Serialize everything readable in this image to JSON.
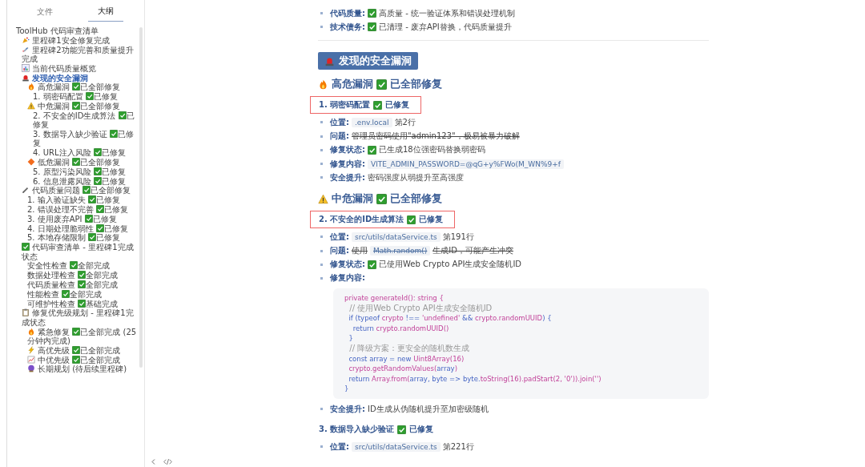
{
  "sidebar": {
    "tabs": [
      {
        "label": "文件",
        "selected": false
      },
      {
        "label": "大纲",
        "selected": true
      }
    ],
    "outline": [
      {
        "text": "ToolHub 代码审查清单",
        "selected": false,
        "children": [
          {
            "text": "里程碑1安全修复完成",
            "kind": "milestone",
            "selected": false
          },
          {
            "text": "里程碑2功能完善和质量提升完成",
            "kind": "launch",
            "selected": false
          },
          {
            "text": "当前代码质量概览",
            "kind": "overview",
            "selected": false
          },
          {
            "text": "发现的安全漏洞",
            "kind": "alert",
            "selected": true,
            "children": [
              {
                "text": "高危漏洞",
                "kind": "high",
                "done": true,
                "status": "已全部修复",
                "selected": false,
                "children": [
                  {
                    "text": "1. 弱密码配置",
                    "done": true,
                    "status": "已修复",
                    "selected": false
                  }
                ]
              },
              {
                "text": "中危漏洞",
                "kind": "medium",
                "done": true,
                "status": "已全部修复",
                "selected": false,
                "children": [
                  {
                    "text": "2. 不安全的ID生成算法",
                    "done": true,
                    "status": "已修复",
                    "selected": false
                  },
                  {
                    "text": "3. 数据导入缺少验证",
                    "done": true,
                    "status": "已修复",
                    "selected": false
                  },
                  {
                    "text": "4. URL注入风险",
                    "done": true,
                    "status": "已修复",
                    "selected": false
                  }
                ]
              },
              {
                "text": "低危漏洞",
                "kind": "low",
                "done": true,
                "status": "已全部修复",
                "selected": false,
                "children": [
                  {
                    "text": "5. 原型污染风险",
                    "done": true,
                    "status": "已修复",
                    "selected": false
                  },
                  {
                    "text": "6. 信息泄露风险",
                    "done": true,
                    "status": "已修复",
                    "selected": false
                  }
                ]
              }
            ]
          },
          {
            "text": "代码质量问题",
            "kind": "quality",
            "done": true,
            "status": "已全部修复",
            "selected": false,
            "children": [
              {
                "text": "1. 输入验证缺失",
                "done": true,
                "status": "已修复",
                "selected": false
              },
              {
                "text": "2. 错误处理不完善",
                "done": true,
                "status": "已修复",
                "selected": false
              },
              {
                "text": "3. 使用废弃API",
                "done": true,
                "status": "已修复",
                "selected": false
              },
              {
                "text": "4. 日期处理脆弱性",
                "done": true,
                "status": "已修复",
                "selected": false
              },
              {
                "text": "5. 本地存储限制",
                "done": true,
                "status": "已修复",
                "selected": false
              }
            ]
          },
          {
            "text": "代码审查清单 - 里程碑1完成状态",
            "kind": "checklist",
            "selected": false,
            "children": [
              {
                "text": "安全性检查",
                "done": true,
                "status": "全部完成",
                "selected": false
              },
              {
                "text": "数据处理检查",
                "done": true,
                "status": "全部完成",
                "selected": false
              },
              {
                "text": "代码质量检查",
                "done": true,
                "status": "全部完成",
                "selected": false
              },
              {
                "text": "性能检查",
                "done": true,
                "status": "全部完成",
                "selected": false
              },
              {
                "text": "可维护性检查",
                "done": true,
                "status": "基础完成",
                "selected": false
              }
            ]
          },
          {
            "text": "修复优先级规划 - 里程碑1完成状态",
            "kind": "plan",
            "selected": false,
            "children": [
              {
                "text": "紧急修复",
                "kind": "urgent",
                "done": true,
                "status": "已全部完成 (25分钟内完成)",
                "selected": false
              },
              {
                "text": "高优先级",
                "kind": "priority-high",
                "done": true,
                "status": "已全部完成",
                "selected": false
              },
              {
                "text": "中优先级",
                "kind": "priority-mid",
                "done": true,
                "status": "已全部完成",
                "selected": false
              },
              {
                "text": "长期规划 (待后续里程碑)",
                "kind": "longterm",
                "selected": false
              }
            ]
          }
        ]
      }
    ]
  },
  "summary": [
    {
      "label": "代码质量:",
      "struck": false,
      "segments": [
        {
          "kind": "check"
        },
        {
          "kind": "text",
          "text": "高质量 - 统一验证体系和错误处理机制"
        }
      ]
    },
    {
      "label": "技术债务:",
      "struck": false,
      "segments": [
        {
          "kind": "check"
        },
        {
          "kind": "text",
          "text": "已清理 - 废弃API替换，代码质量提升"
        }
      ]
    }
  ],
  "section": {
    "title": "发现的安全漏洞",
    "kind": "alert",
    "groups": [
      {
        "title": "高危漏洞",
        "kind": "high",
        "done": true,
        "status": "已全部修复",
        "issues": [
          {
            "title": "1. 弱密码配置",
            "done": true,
            "status": "已修复",
            "highlighted": true,
            "bullets": [
              {
                "label": "位置:",
                "struck": false,
                "segments": [
                  {
                    "kind": "code",
                    "text": ".env.local"
                  },
                  {
                    "kind": "text",
                    "text": "第2行"
                  }
                ]
              },
              {
                "label": "问题:",
                "struck": true,
                "segments": [
                  {
                    "kind": "text",
                    "text": "管理员密码使用\"admin123\"，极易被暴力破解"
                  }
                ]
              },
              {
                "label": "修复状态:",
                "struck": false,
                "segments": [
                  {
                    "kind": "check"
                  },
                  {
                    "kind": "text",
                    "text": "已生成18位强密码替换弱密码"
                  }
                ]
              },
              {
                "label": "修复内容:",
                "struck": false,
                "segments": [
                  {
                    "kind": "code",
                    "text": "VITE_ADMIN_PASSWORD=@qG+y%FWo(M_WN%9+f"
                  }
                ]
              },
              {
                "label": "安全提升:",
                "struck": false,
                "segments": [
                  {
                    "kind": "text",
                    "text": "密码强度从弱提升至高强度"
                  }
                ]
              }
            ]
          }
        ]
      },
      {
        "title": "中危漏洞",
        "kind": "medium",
        "done": true,
        "status": "已全部修复",
        "issues": [
          {
            "title": "2. 不安全的ID生成算法",
            "done": true,
            "status": "已修复",
            "highlighted": true,
            "bullets": [
              {
                "label": "位置:",
                "struck": false,
                "segments": [
                  {
                    "kind": "code",
                    "text": "src/utils/dataService.ts"
                  },
                  {
                    "kind": "text",
                    "text": "第191行"
                  }
                ]
              },
              {
                "label": "问题:",
                "struck": true,
                "segments": [
                  {
                    "kind": "text",
                    "text": "使用"
                  },
                  {
                    "kind": "code",
                    "text": "Math.random()"
                  },
                  {
                    "kind": "text",
                    "text": "生成ID，可能产生冲突"
                  }
                ]
              },
              {
                "label": "修复状态:",
                "struck": false,
                "segments": [
                  {
                    "kind": "check"
                  },
                  {
                    "kind": "text",
                    "text": "已使用Web Crypto API生成安全随机ID"
                  }
                ]
              },
              {
                "label": "修复内容:",
                "code_block": [
                  [
                    {
                      "kind": "keyword",
                      "text": "private generateId(): string {"
                    }
                  ],
                  [
                    {
                      "kind": "comment",
                      "text": "  // 使用Web Crypto API生成安全随机ID"
                    }
                  ],
                  [
                    {
                      "kind": "name",
                      "text": "  if (typeof "
                    },
                    {
                      "kind": "keyword",
                      "text": "crypto"
                    },
                    {
                      "kind": "name",
                      "text": " !== "
                    },
                    {
                      "kind": "keyword",
                      "text": "'undefined'"
                    },
                    {
                      "kind": "name",
                      "text": " && "
                    },
                    {
                      "kind": "keyword",
                      "text": "crypto.randomUUID"
                    },
                    {
                      "kind": "name",
                      "text": ") {"
                    }
                  ],
                  [
                    {
                      "kind": "name",
                      "text": "    return "
                    },
                    {
                      "kind": "keyword",
                      "text": "crypto.randomUUID()"
                    }
                  ],
                  [
                    {
                      "kind": "name",
                      "text": "  }"
                    }
                  ],
                  [
                    {
                      "kind": "comment",
                      "text": "  // 降级方案：更安全的随机数生成"
                    }
                  ],
                  [
                    {
                      "kind": "name",
                      "text": "  const array = new "
                    },
                    {
                      "kind": "keyword",
                      "text": "Uint8Array(16)"
                    }
                  ],
                  [
                    {
                      "kind": "keyword",
                      "text": "  crypto.getRandomValues("
                    },
                    {
                      "kind": "name",
                      "text": "array"
                    },
                    {
                      "kind": "keyword",
                      "text": ")"
                    }
                  ],
                  [
                    {
                      "kind": "name",
                      "text": "  return "
                    },
                    {
                      "kind": "keyword",
                      "text": "Array.from("
                    },
                    {
                      "kind": "name",
                      "text": "array, byte => byte."
                    },
                    {
                      "kind": "keyword",
                      "text": "toString(16).padStart(2, '0')).join('')"
                    }
                  ],
                  [
                    {
                      "kind": "name",
                      "text": "}"
                    }
                  ]
                ]
              },
              {
                "label": "安全提升:",
                "struck": false,
                "segments": [
                  {
                    "kind": "text",
                    "text": "ID生成从伪随机提升至加密级随机"
                  }
                ]
              }
            ]
          },
          {
            "title": "3. 数据导入缺少验证",
            "done": true,
            "status": "已修复",
            "highlighted": false,
            "bullets": [
              {
                "label": "位置:",
                "struck": false,
                "segments": [
                  {
                    "kind": "code",
                    "text": "src/utils/dataService.ts"
                  },
                  {
                    "kind": "text",
                    "text": "第221行"
                  }
                ]
              }
            ]
          }
        ]
      }
    ]
  }
}
